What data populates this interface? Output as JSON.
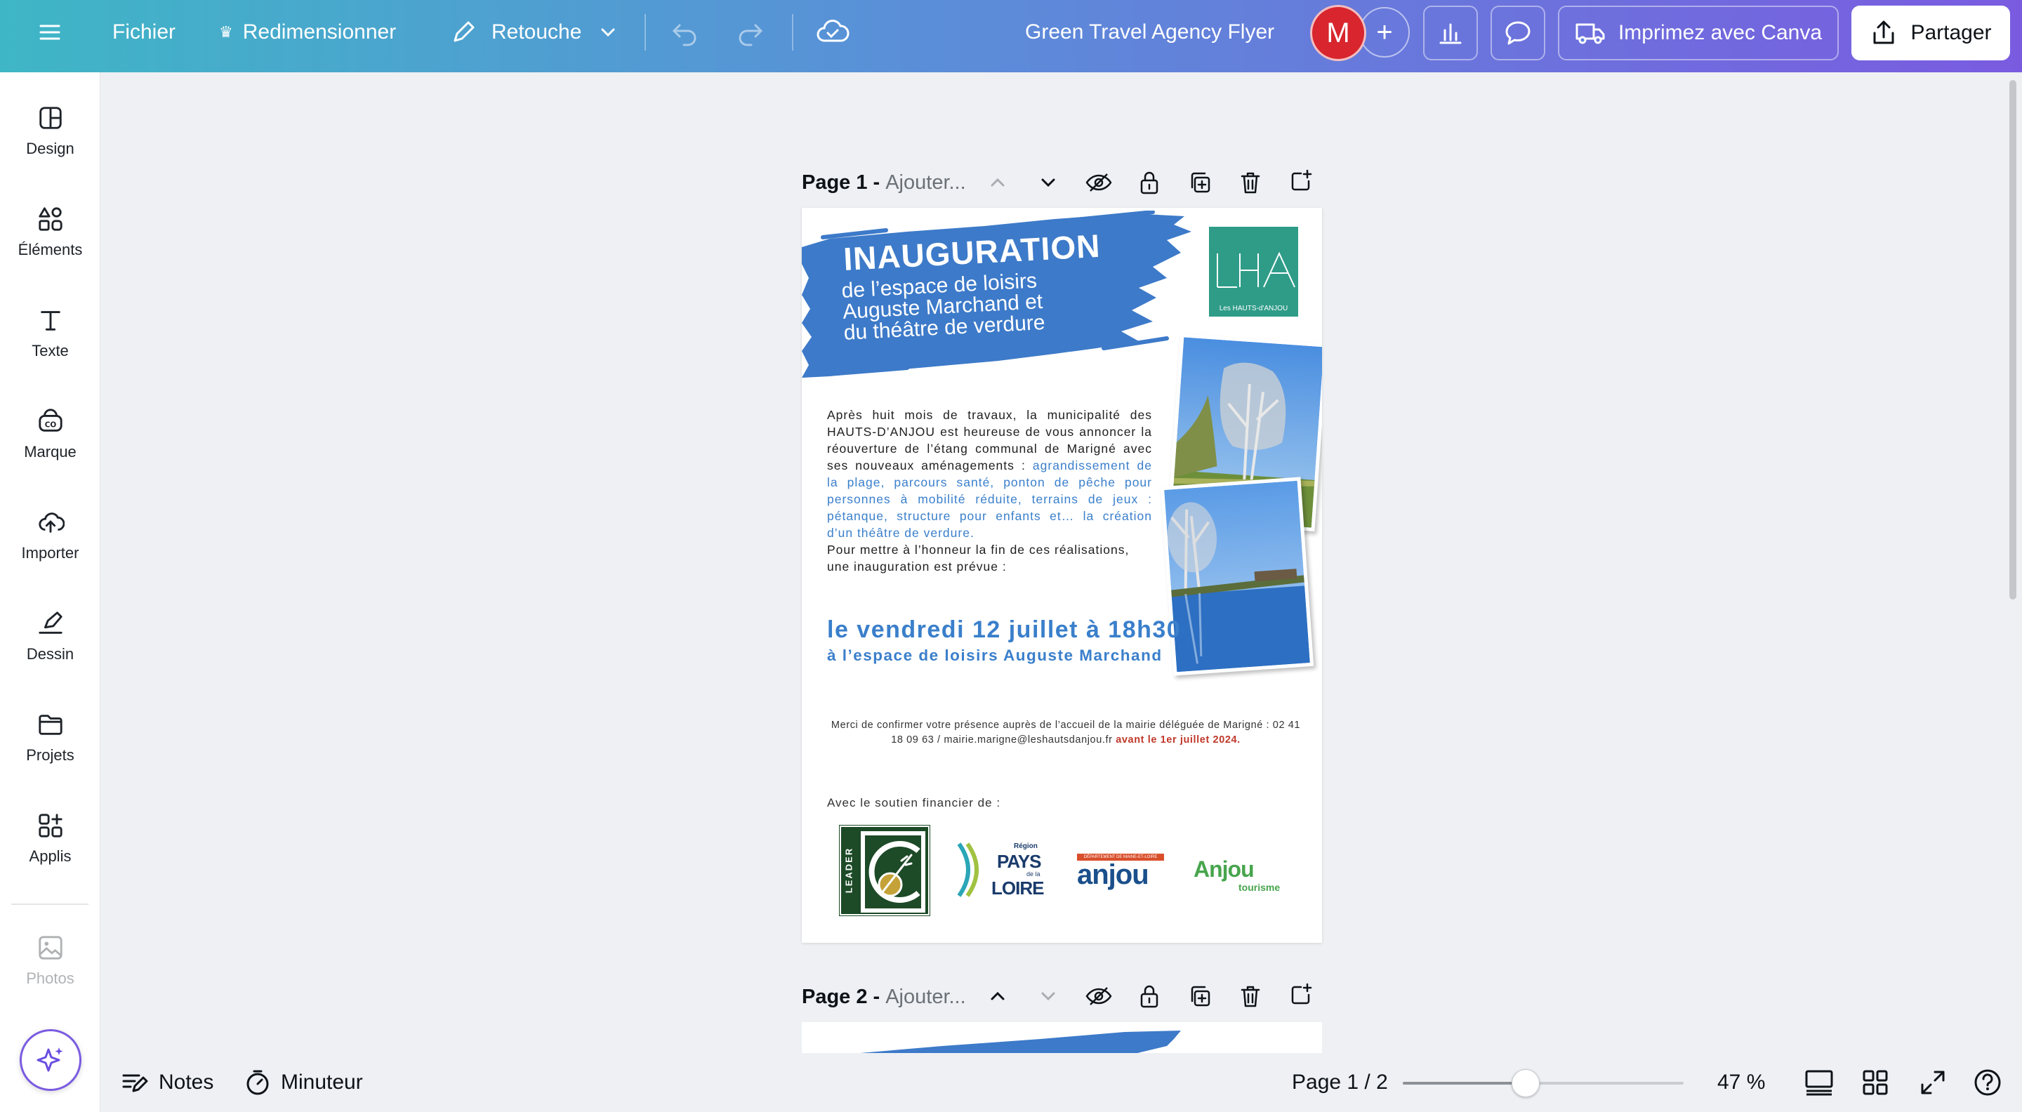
{
  "topbar": {
    "file_label": "Fichier",
    "resize_label": "Redimensionner",
    "retouch_label": "Retouche",
    "doc_title": "Green Travel Agency Flyer",
    "avatar_initial": "M",
    "print_label": "Imprimez avec Canva",
    "share_label": "Partager"
  },
  "sidebar": {
    "items": [
      {
        "label": "Design",
        "icon": "design-icon"
      },
      {
        "label": "Éléments",
        "icon": "elements-icon"
      },
      {
        "label": "Texte",
        "icon": "text-icon"
      },
      {
        "label": "Marque",
        "icon": "brand-icon"
      },
      {
        "label": "Importer",
        "icon": "upload-icon"
      },
      {
        "label": "Dessin",
        "icon": "draw-icon"
      },
      {
        "label": "Projets",
        "icon": "folder-icon"
      },
      {
        "label": "Applis",
        "icon": "apps-icon"
      },
      {
        "label": "Photos",
        "icon": "photos-icon"
      }
    ]
  },
  "pages": [
    {
      "name": "Page 1 -",
      "title_placeholder": "Ajouter..."
    },
    {
      "name": "Page 2 -",
      "title_placeholder": "Ajouter..."
    }
  ],
  "flyer": {
    "title": "INAUGURATION",
    "subtitle_lines": [
      "de l’espace de loisirs",
      "Auguste Marchand et",
      "du théâtre de verdure"
    ],
    "logo_caption": "Les HAUTS-d'ANJOU",
    "body_intro": "Après huit mois de travaux, la municipalité des HAUTS-D’ANJOU est heureuse de vous annoncer la réouverture de l’étang communal de Marigné avec ses nouveaux aménagements :",
    "body_highlight": "agrandissement de la plage, parcours santé, ponton de pêche pour personnes à mobilité réduite, terrains de jeux : pétanque, structure pour enfants et… la création d’un théâtre de verdure.",
    "body_outro": "Pour mettre à l’honneur la fin de ces réalisations, une inauguration est prévue :",
    "date_line": "le vendredi 12 juillet à 18h30",
    "place_line": "à l’espace de loisirs Auguste Marchand",
    "rsvp_text": "Merci de confirmer votre présence auprès de l’accueil de la mairie déléguée de Marigné : 02 41 18 09 63 / mairie.marigne@leshautsdanjou.fr",
    "rsvp_deadline": "avant le 1er juillet 2024.",
    "support_label": "Avec le soutien financier de :",
    "sponsors": {
      "leader": "LEADER",
      "pays_loire_region": "Région",
      "pays_loire_main": "PAYS",
      "pays_loire_dela": "de la",
      "pays_loire_loire": "LOIRE",
      "anjou_dept": "DÉPARTEMENT DE MAINE-ET-LOIRE",
      "anjou_main": "anjou",
      "anjou_tourisme_main": "Anjou",
      "anjou_tourisme_sub": "tourisme"
    }
  },
  "bottombar": {
    "notes_label": "Notes",
    "timer_label": "Minuteur",
    "page_indicator": "Page 1 / 2",
    "zoom": "47 %",
    "zoom_fraction": 0.47
  },
  "colors": {
    "accent_blue": "#3a7fcb",
    "brush_blue": "#3d7ac9",
    "logo_green": "#2f9c88",
    "avatar_red": "#d8252e"
  }
}
